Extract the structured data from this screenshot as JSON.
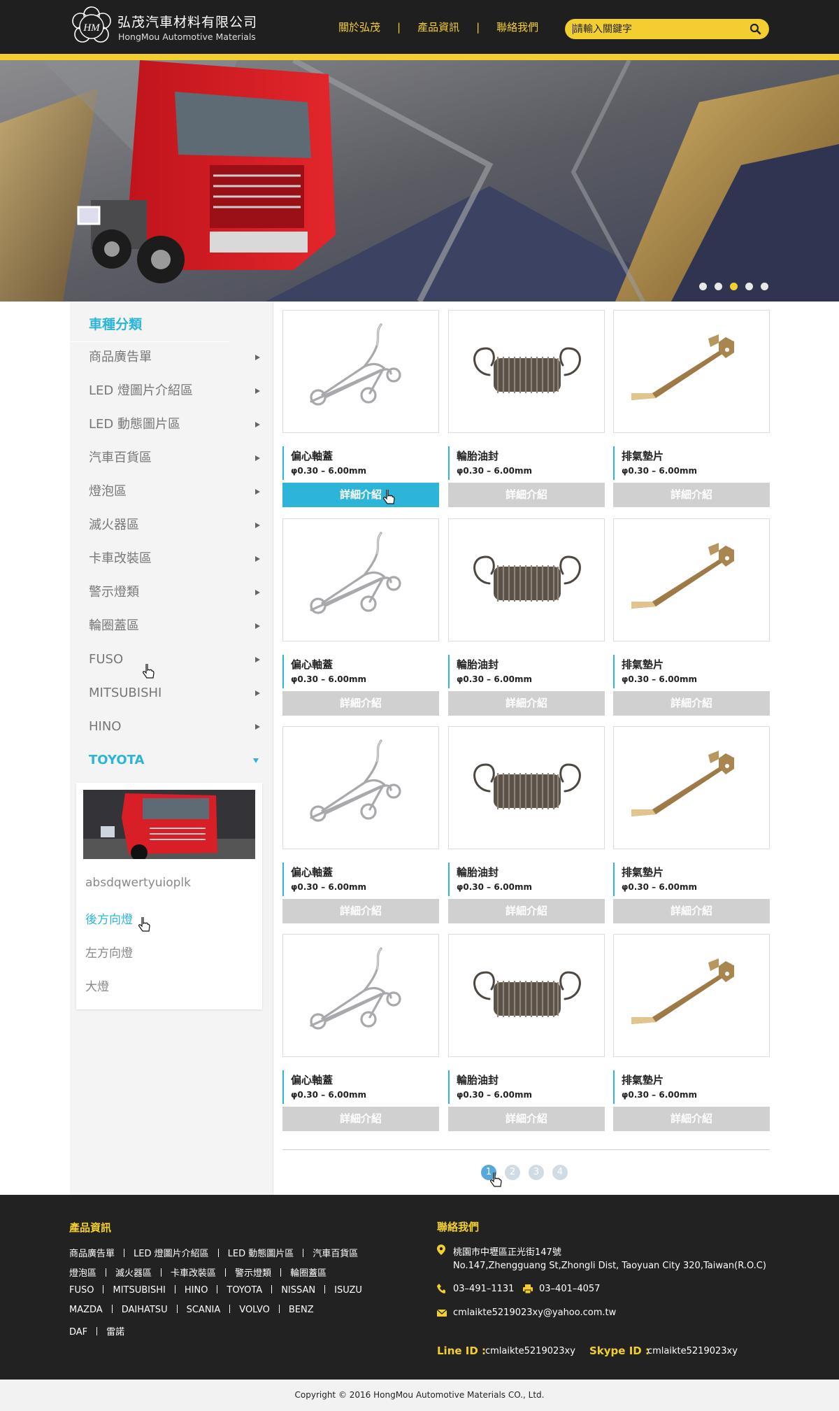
{
  "header": {
    "brand_zh": "弘茂汽車材料有限公司",
    "brand_en": "HongMou Automotive Materials",
    "logo_text": "HM",
    "nav": [
      "關於弘茂",
      "產品資訊",
      "聯絡我們"
    ],
    "search_placeholder": "請輸入關鍵字",
    "accent_color": "#f2cf2f"
  },
  "banner": {
    "dots": 5,
    "active_dot": 3
  },
  "sidebar": {
    "title": "車種分類",
    "categories": [
      "商品廣告單",
      "LED 燈圖片介紹區",
      "LED 動態圖片區",
      "汽車百貨區",
      "燈泡區",
      "滅火器區",
      "卡車改裝區",
      "警示燈類",
      "輪圈蓋區",
      "FUSO",
      "MITSUBISHI",
      "HINO",
      "TOYOTA"
    ],
    "active_category": "TOYOTA",
    "subitems": [
      "absdqwertyuioplk",
      "後方向燈",
      "左方向燈",
      "大燈"
    ],
    "active_subitem": "後方向燈",
    "active_color": "#2cb5d9"
  },
  "products": [
    {
      "name": "偏心軸蓋",
      "spec": "φ0.30 – 6.00mm",
      "button": "詳細介紹",
      "image": "wire-clip"
    },
    {
      "name": "輪胎油封",
      "spec": "φ0.30 – 6.00mm",
      "button": "詳細介紹",
      "image": "tension-spring"
    },
    {
      "name": "排氣墊片",
      "spec": "φ0.30 – 6.00mm",
      "button": "詳細介紹",
      "image": "bent-brass-strip"
    },
    {
      "name": "偏心軸蓋",
      "spec": "φ0.30 – 6.00mm",
      "button": "詳細介紹",
      "image": "wire-clip"
    },
    {
      "name": "輪胎油封",
      "spec": "φ0.30 – 6.00mm",
      "button": "詳細介紹",
      "image": "tension-spring"
    },
    {
      "name": "排氣墊片",
      "spec": "φ0.30 – 6.00mm",
      "button": "詳細介紹",
      "image": "bent-brass-strip"
    },
    {
      "name": "偏心軸蓋",
      "spec": "φ0.30 – 6.00mm",
      "button": "詳細介紹",
      "image": "wire-clip"
    },
    {
      "name": "輪胎油封",
      "spec": "φ0.30 – 6.00mm",
      "button": "詳細介紹",
      "image": "tension-spring"
    },
    {
      "name": "排氣墊片",
      "spec": "φ0.30 – 6.00mm",
      "button": "詳細介紹",
      "image": "bent-brass-strip"
    },
    {
      "name": "偏心軸蓋",
      "spec": "φ0.30 – 6.00mm",
      "button": "詳細介紹",
      "image": "wire-clip"
    },
    {
      "name": "輪胎油封",
      "spec": "φ0.30 – 6.00mm",
      "button": "詳細介紹",
      "image": "tension-spring"
    },
    {
      "name": "排氣墊片",
      "spec": "φ0.30 – 6.00mm",
      "button": "詳細介紹",
      "image": "bent-brass-strip"
    }
  ],
  "active_product_button": 0,
  "pagination": {
    "pages": [
      "1",
      "2",
      "3",
      "4"
    ],
    "current": "1"
  },
  "footer": {
    "products_title": "產品資訊",
    "link_rows": [
      [
        "商品廣告單",
        "LED 燈圖片介紹區",
        "LED 動態圖片區",
        "汽車百貨區"
      ],
      [
        "燈泡區",
        "滅火器區",
        "卡車改裝區",
        "警示燈類",
        "輪圈蓋區"
      ],
      [
        "FUSO",
        "MITSUBISHI",
        "HINO",
        "TOYOTA",
        "NISSAN",
        "ISUZU"
      ],
      [
        "MAZDA",
        "DAIHATSU",
        "SCANIA",
        "VOLVO",
        "BENZ"
      ],
      [
        "DAF",
        "雷諾"
      ]
    ],
    "contact_title": "聯絡我們",
    "address_zh": "桃園市中壢區正光街147號",
    "address_en": "No.147,Zhengguang St,Zhongli Dist, Taoyuan City 320,Taiwan(R.O.C)",
    "phone": "03–491–1131",
    "fax": "03–401–4057",
    "email": "cmlaikte5219023xy@yahoo.com.tw",
    "line_label": "Line ID :",
    "line_id": "cmlaikte5219023xy",
    "skype_label": "Skype ID :",
    "skype_id": "cmlaikte5219023xy"
  },
  "copyright": "Copyright  ©  2016 HongMou Automotive Materials CO., Ltd."
}
